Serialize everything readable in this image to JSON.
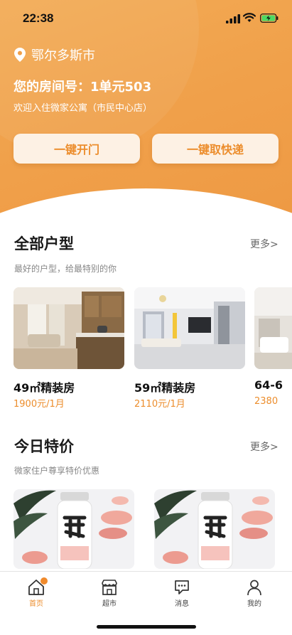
{
  "status": {
    "time": "22:38"
  },
  "header": {
    "location": "鄂尔多斯市",
    "room_label": "您的房间号：",
    "room_number": "1单元503",
    "welcome": "欢迎入住微家公寓（市民中心店）",
    "open_door": "一键开门",
    "pickup": "一键取快递"
  },
  "rooms_section": {
    "title": "全部户型",
    "more": "更多>",
    "subtitle": "最好的户型，给最特别的你",
    "cards": [
      {
        "name": "49㎡精装房",
        "price": "1900元/1月"
      },
      {
        "name": "59㎡精装房",
        "price": "2110元/1月"
      },
      {
        "name": "64-6",
        "price": "2380"
      }
    ]
  },
  "deals_section": {
    "title": "今日特价",
    "more": "更多>",
    "subtitle": "微家住户尊享特价优惠"
  },
  "tabbar": {
    "items": [
      {
        "label": "首页",
        "icon": "home-icon",
        "active": true
      },
      {
        "label": "超市",
        "icon": "store-icon",
        "active": false
      },
      {
        "label": "消息",
        "icon": "message-icon",
        "active": false
      },
      {
        "label": "我的",
        "icon": "user-icon",
        "active": false
      }
    ]
  },
  "colors": {
    "accent": "#ec8d2c",
    "header": "#f0a04a"
  }
}
